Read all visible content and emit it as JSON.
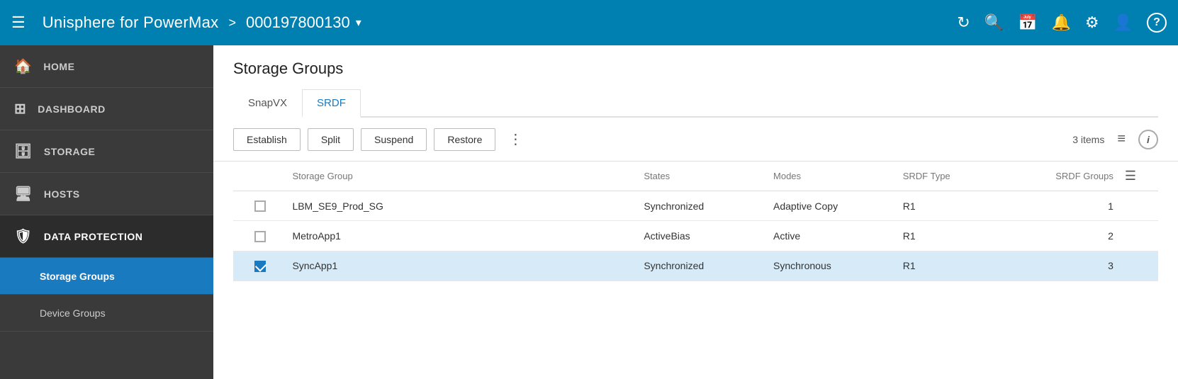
{
  "topbar": {
    "hamburger_label": "☰",
    "app_title": "Unisphere for PowerMax",
    "chevron": ">",
    "device_id": "000197800130",
    "dropdown_icon": "▾",
    "icons": [
      {
        "name": "refresh-icon",
        "symbol": "↻"
      },
      {
        "name": "search-icon",
        "symbol": "🔍"
      },
      {
        "name": "calendar-icon",
        "symbol": "📅"
      },
      {
        "name": "bell-icon",
        "symbol": "🔔"
      },
      {
        "name": "gear-icon",
        "symbol": "⚙"
      },
      {
        "name": "user-icon",
        "symbol": "👤"
      },
      {
        "name": "help-icon",
        "symbol": "?"
      }
    ]
  },
  "sidebar": {
    "items": [
      {
        "id": "home",
        "label": "HOME",
        "icon": "🏠"
      },
      {
        "id": "dashboard",
        "label": "DASHBOARD",
        "icon": "⊞"
      },
      {
        "id": "storage",
        "label": "STORAGE",
        "icon": "🗄"
      },
      {
        "id": "hosts",
        "label": "HOSTS",
        "icon": "🖥"
      },
      {
        "id": "data-protection",
        "label": "DATA PROTECTION",
        "icon": "🛡",
        "active": true
      }
    ],
    "sub_items": [
      {
        "id": "storage-groups",
        "label": "Storage Groups",
        "active": true
      },
      {
        "id": "device-groups",
        "label": "Device Groups",
        "active": false
      }
    ]
  },
  "page": {
    "title": "Storage Groups"
  },
  "tabs": [
    {
      "id": "snapvx",
      "label": "SnapVX",
      "active": false
    },
    {
      "id": "srdf",
      "label": "SRDF",
      "active": true
    }
  ],
  "toolbar": {
    "establish_label": "Establish",
    "split_label": "Split",
    "suspend_label": "Suspend",
    "restore_label": "Restore",
    "more_icon": "⋮",
    "items_count": "3 items",
    "filter_icon": "≡",
    "info_icon": "i"
  },
  "table": {
    "columns": [
      {
        "id": "checkbox",
        "label": ""
      },
      {
        "id": "storage-group",
        "label": "Storage Group"
      },
      {
        "id": "states",
        "label": "States"
      },
      {
        "id": "modes",
        "label": "Modes"
      },
      {
        "id": "srdf-type",
        "label": "SRDF Type"
      },
      {
        "id": "srdf-groups",
        "label": "SRDF Groups"
      },
      {
        "id": "menu",
        "label": ""
      }
    ],
    "rows": [
      {
        "id": "row1",
        "checked": false,
        "selected": false,
        "storage_group": "LBM_SE9_Prod_SG",
        "states": "Synchronized",
        "modes": "Adaptive Copy",
        "srdf_type": "R1",
        "srdf_groups": "1"
      },
      {
        "id": "row2",
        "checked": false,
        "selected": false,
        "storage_group": "MetroApp1",
        "states": "ActiveBias",
        "modes": "Active",
        "srdf_type": "R1",
        "srdf_groups": "2"
      },
      {
        "id": "row3",
        "checked": true,
        "selected": true,
        "storage_group": "SyncApp1",
        "states": "Synchronized",
        "modes": "Synchronous",
        "srdf_type": "R1",
        "srdf_groups": "3"
      }
    ]
  }
}
